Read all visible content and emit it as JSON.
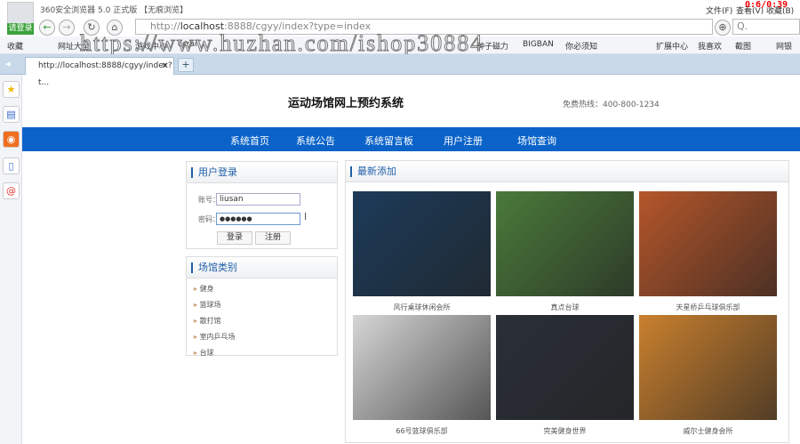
{
  "browser": {
    "title": "360安全浏览器 5.0 正式版 【无痕浏览】",
    "login_badge": "请登录",
    "url_prefix": "http://",
    "url_host": "localhost",
    "url_rest": ":8888/cgyy/index?type=index",
    "menu": [
      "文件(F)",
      "查看(V)",
      "收藏(B)"
    ],
    "timer": "0:6/0:39",
    "search_placeholder": "Q."
  },
  "bookmarks": [
    "收藏",
    "网址大全",
    "游戏中心",
    "ccrai",
    "种子磁力",
    "BIGBAN",
    "你必须知"
  ],
  "bookmarks_right": [
    "扩展中心",
    "我喜欢",
    "截图",
    "网银"
  ],
  "watermark": "https://www.huzhan.com/ishop30884",
  "tab": {
    "title": "http://localhost:8888/cgyy/index?t...",
    "close": "×",
    "new": "+"
  },
  "site": {
    "title": "运动场馆网上预约系统",
    "hotline": "免费热线：400-800-1234"
  },
  "nav": [
    "系统首页",
    "系统公告",
    "系统留言板",
    "用户注册",
    "场馆查询"
  ],
  "login": {
    "heading": "用户登录",
    "account_label": "账号：",
    "account_value": "liusan",
    "password_label": "密码：",
    "password_value": "●●●●●●",
    "login_btn": "登录",
    "register_btn": "注册"
  },
  "categories": {
    "heading": "场馆类别",
    "items": [
      "健身",
      "篮球场",
      "散打馆",
      "室内乒乓场",
      "台球"
    ]
  },
  "latest": {
    "heading": "最新添加",
    "items": [
      {
        "name": "风行桌球休闲会所",
        "color": "#1c3b5a"
      },
      {
        "name": "真点台球",
        "color": "#4a7a3a"
      },
      {
        "name": "天星桥乒乓球俱乐部",
        "color": "#b5562a"
      },
      {
        "name": "66号篮球俱乐部",
        "color": "#d6d6d6"
      },
      {
        "name": "完美健身世界",
        "color": "#2a2f38"
      },
      {
        "name": "威尔士健身会所",
        "color": "#c9802e"
      }
    ]
  }
}
